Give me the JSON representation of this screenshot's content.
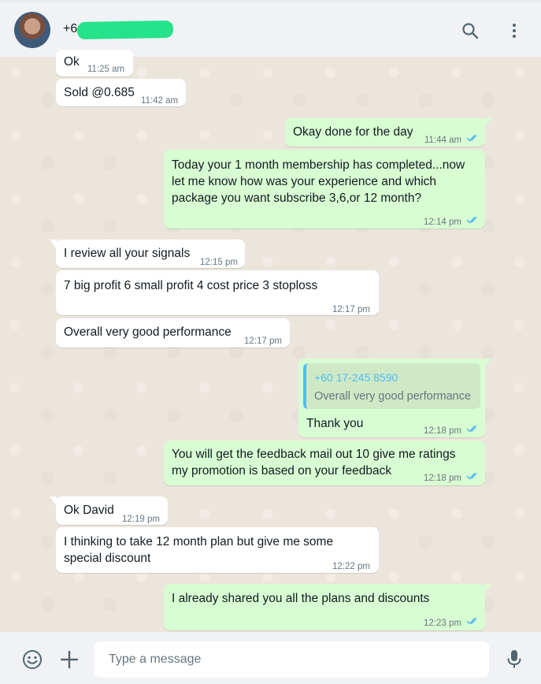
{
  "header": {
    "contact_name": "+6"
  },
  "messages": [
    {
      "id": "m1",
      "dir": "in",
      "text": "Ok",
      "time": "11:25 am"
    },
    {
      "id": "m2",
      "dir": "in",
      "text": "Sold @0.685",
      "time": "11:42 am"
    },
    {
      "id": "m3",
      "dir": "out",
      "text": "Okay done for the day",
      "time": "11:44 am"
    },
    {
      "id": "m4",
      "dir": "out",
      "text": "Today your 1 month membership has completed...now\nlet me know how was your experience and which\npackage you want subscribe 3,6,or 12 month?",
      "time": "12:14 pm"
    },
    {
      "id": "m5",
      "dir": "in",
      "text": "I review all your signals",
      "time": "12:15 pm"
    },
    {
      "id": "m6",
      "dir": "in",
      "text": "7 big profit 6 small profit 4 cost price 3 stoploss",
      "time": "12:17 pm"
    },
    {
      "id": "m7",
      "dir": "in",
      "text": "Overall very good performance",
      "time": "12:17 pm"
    },
    {
      "id": "m8",
      "dir": "out",
      "text": "Thank you",
      "time": "12:18 pm",
      "quote": {
        "name": "+60 17-245 8590",
        "text": "Overall very good performance"
      }
    },
    {
      "id": "m9",
      "dir": "out",
      "text": "You will get the feedback mail out 10 give me ratings\nmy promotion is based on your feedback",
      "time": "12:18 pm"
    },
    {
      "id": "m10",
      "dir": "in",
      "text": "Ok David",
      "time": "12:19 pm"
    },
    {
      "id": "m11",
      "dir": "in",
      "text": "I thinking to take 12 month plan but give me some\nspecial discount",
      "time": "12:22 pm"
    },
    {
      "id": "m12",
      "dir": "out",
      "text": "I already shared you all the plans and discounts",
      "time": "12:23 pm"
    }
  ],
  "composer": {
    "placeholder": "Type a message"
  },
  "icons": {
    "header": [
      "search-icon",
      "menu-icon"
    ],
    "composer": [
      "emoji-icon",
      "plus-icon",
      "microphone-icon"
    ]
  },
  "colors": {
    "incoming_bubble": "#ffffff",
    "outgoing_bubble": "#d9fdd3",
    "read_ticks": "#53bdeb",
    "timestamp": "#667781"
  }
}
